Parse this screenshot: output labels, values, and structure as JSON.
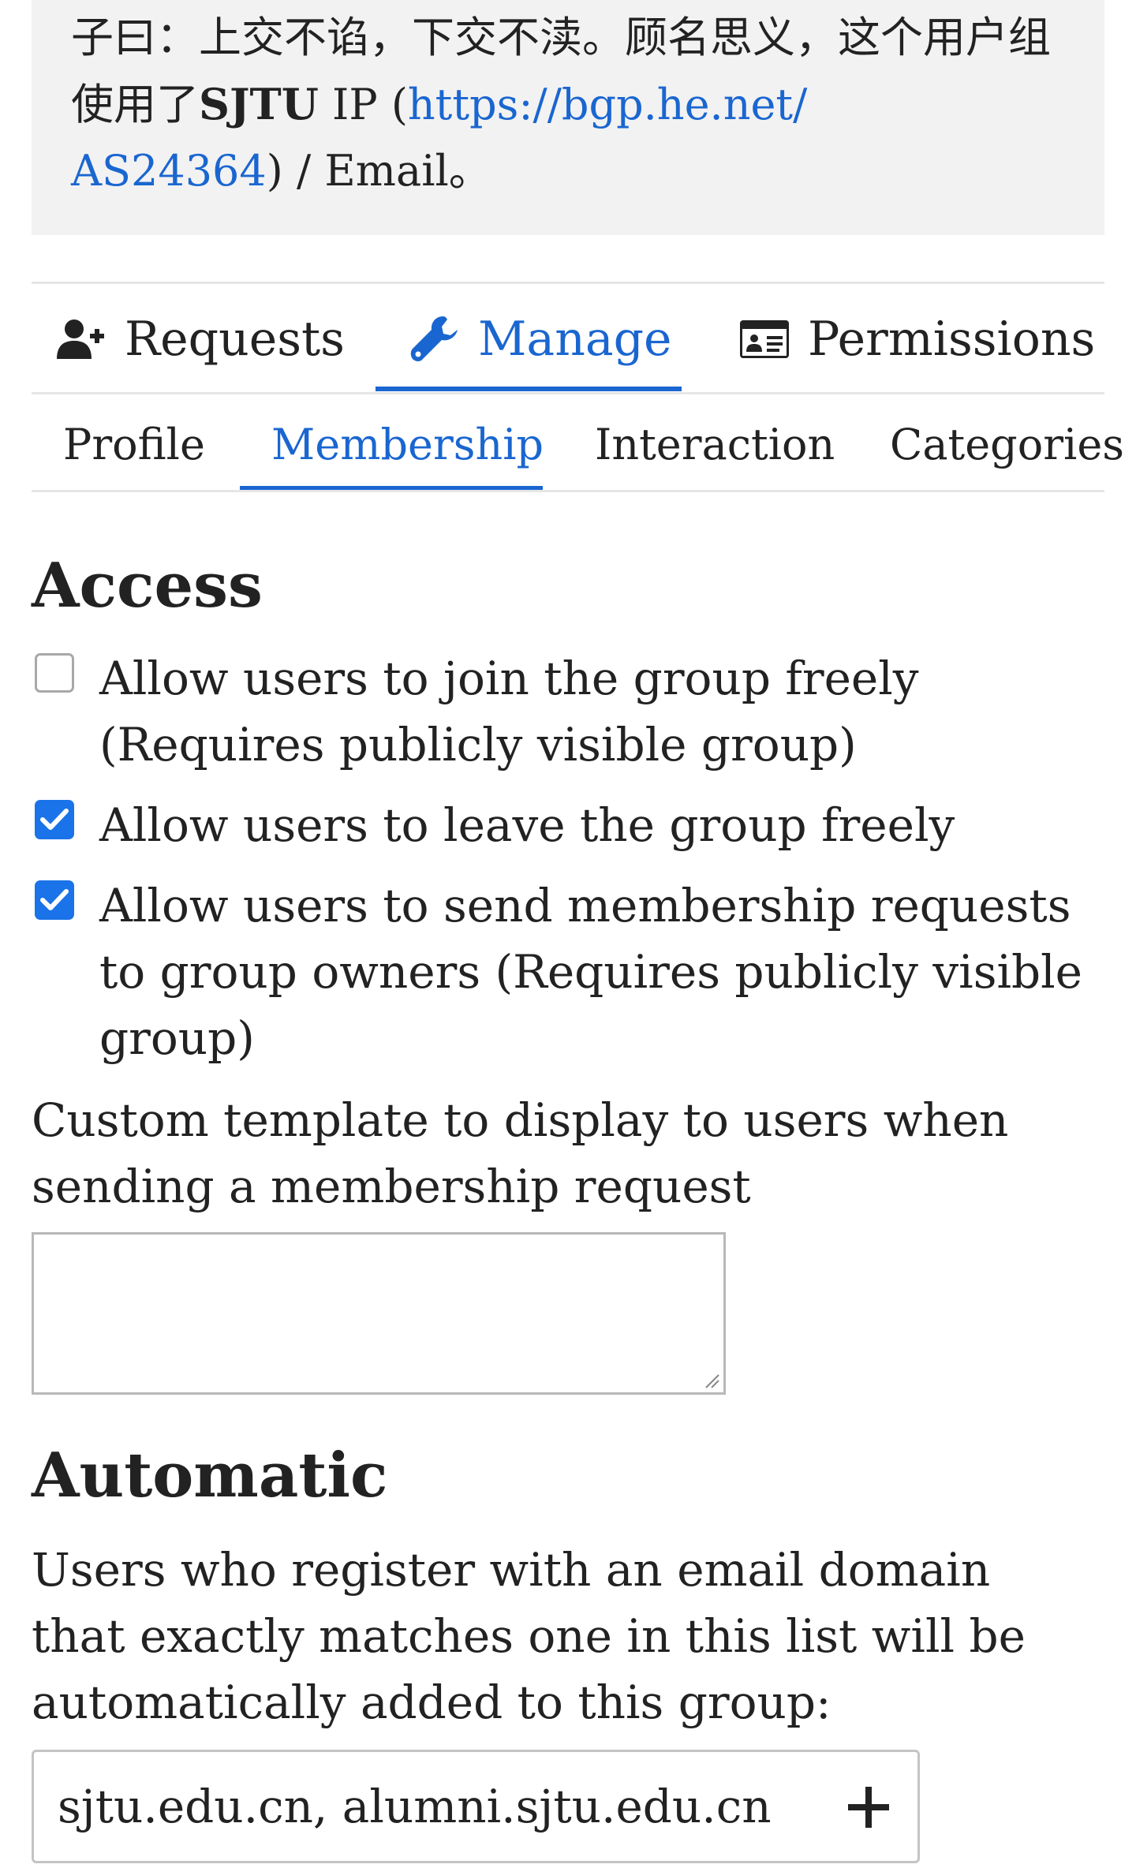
{
  "description": {
    "text_before": "子曰：上交不谄，下交不渎。顾名思义，这个用户组使用了",
    "bold_text": "SJTU",
    "text_ip": " IP (",
    "link_line1": "https://bgp.he.net/",
    "link_line2": "AS24364",
    "text_after": ") / Email。"
  },
  "tabs": [
    {
      "label": "Requests",
      "icon": "user-plus-icon"
    },
    {
      "label": "Manage",
      "icon": "wrench-icon",
      "active": true
    },
    {
      "label": "Permissions",
      "icon": "id-card-icon"
    }
  ],
  "subtabs": [
    {
      "label": "Profile"
    },
    {
      "label": "Membership",
      "active": true
    },
    {
      "label": "Interaction"
    },
    {
      "label": "Categories"
    }
  ],
  "access": {
    "heading": "Access",
    "options": [
      {
        "label": "Allow users to join the group freely (Requires publicly visible group)",
        "checked": false
      },
      {
        "label": "Allow users to leave the group freely",
        "checked": true
      },
      {
        "label": "Allow users to send membership requests to group owners (Requires publicly visible group)",
        "checked": true
      }
    ],
    "template_label": "Custom template to display to users when sending a membership request",
    "template_value": ""
  },
  "automatic": {
    "heading": "Automatic",
    "description": "Users who register with an email domain that exactly matches one in this list will be automatically added to this group:",
    "domains_value": "sjtu.edu.cn, alumni.sjtu.edu.cn"
  },
  "colors": {
    "accent": "#1a66d0",
    "checkbox": "#1a73e8",
    "desc_background": "#f2f2f2"
  }
}
